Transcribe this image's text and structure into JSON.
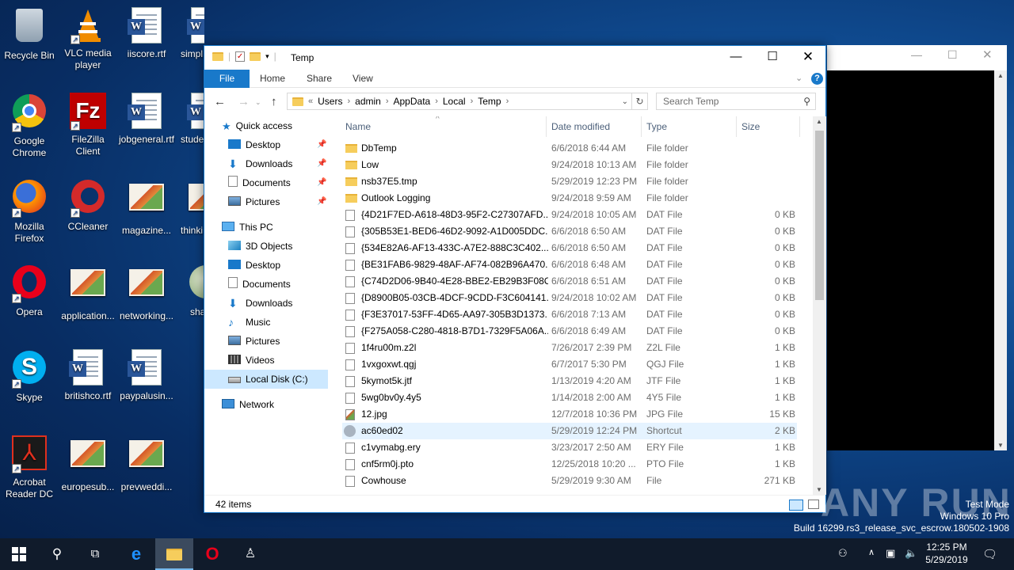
{
  "desktop": {
    "icons": [
      {
        "label": "Recycle Bin",
        "kind": "recycle"
      },
      {
        "label": "VLC media player",
        "kind": "vlc"
      },
      {
        "label": "iiscore.rtf",
        "kind": "word"
      },
      {
        "label": "simpl...",
        "kind": "word"
      },
      {
        "label": "Google Chrome",
        "kind": "chrome"
      },
      {
        "label": "FileZilla Client",
        "kind": "filezilla"
      },
      {
        "label": "jobgeneral.rtf",
        "kind": "word"
      },
      {
        "label": "stude...",
        "kind": "word"
      },
      {
        "label": "Mozilla Firefox",
        "kind": "firefox"
      },
      {
        "label": "CCleaner",
        "kind": "ccleaner"
      },
      {
        "label": "magazine...",
        "kind": "picture"
      },
      {
        "label": "thinki...",
        "kind": "picture"
      },
      {
        "label": "Opera",
        "kind": "opera"
      },
      {
        "label": "application...",
        "kind": "picture"
      },
      {
        "label": "networking...",
        "kind": "picture"
      },
      {
        "label": "sha...",
        "kind": "picture"
      },
      {
        "label": "Skype",
        "kind": "skype"
      },
      {
        "label": "britishco.rtf",
        "kind": "word"
      },
      {
        "label": "paypalusin...",
        "kind": "word"
      },
      {
        "label": "Acrobat Reader DC",
        "kind": "acrobat"
      },
      {
        "label": "europesub...",
        "kind": "picture"
      },
      {
        "label": "prevweddi...",
        "kind": "picture"
      }
    ]
  },
  "explorer": {
    "title": "Temp",
    "ribbon_tabs": [
      "File",
      "Home",
      "Share",
      "View"
    ],
    "address": {
      "prefix": "«",
      "crumbs": [
        "Users",
        "admin",
        "AppData",
        "Local",
        "Temp"
      ]
    },
    "search_placeholder": "Search Temp",
    "nav": {
      "quick_access": "Quick access",
      "quick_items": [
        "Desktop",
        "Downloads",
        "Documents",
        "Pictures"
      ],
      "this_pc": "This PC",
      "pc_items": [
        "3D Objects",
        "Desktop",
        "Documents",
        "Downloads",
        "Music",
        "Pictures",
        "Videos",
        "Local Disk (C:)"
      ],
      "network": "Network"
    },
    "columns": [
      "Name",
      "Date modified",
      "Type",
      "Size"
    ],
    "files": [
      {
        "name": "DbTemp",
        "date": "6/6/2018 6:44 AM",
        "type": "File folder",
        "size": "",
        "icon": "folder"
      },
      {
        "name": "Low",
        "date": "9/24/2018 10:13 AM",
        "type": "File folder",
        "size": "",
        "icon": "folder"
      },
      {
        "name": "nsb37E5.tmp",
        "date": "5/29/2019 12:23 PM",
        "type": "File folder",
        "size": "",
        "icon": "folder"
      },
      {
        "name": "Outlook Logging",
        "date": "9/24/2018 9:59 AM",
        "type": "File folder",
        "size": "",
        "icon": "folder"
      },
      {
        "name": "{4D21F7ED-A618-48D3-95F2-C27307AFD...",
        "date": "9/24/2018 10:05 AM",
        "type": "DAT File",
        "size": "0 KB",
        "icon": "file"
      },
      {
        "name": "{305B53E1-BED6-46D2-9092-A1D005DDC...",
        "date": "6/6/2018 6:50 AM",
        "type": "DAT File",
        "size": "0 KB",
        "icon": "file"
      },
      {
        "name": "{534E82A6-AF13-433C-A7E2-888C3C402...",
        "date": "6/6/2018 6:50 AM",
        "type": "DAT File",
        "size": "0 KB",
        "icon": "file"
      },
      {
        "name": "{BE31FAB6-9829-48AF-AF74-082B96A470...",
        "date": "6/6/2018 6:48 AM",
        "type": "DAT File",
        "size": "0 KB",
        "icon": "file"
      },
      {
        "name": "{C74D2D06-9B40-4E28-BBE2-EB29B3F08C...",
        "date": "6/6/2018 6:51 AM",
        "type": "DAT File",
        "size": "0 KB",
        "icon": "file"
      },
      {
        "name": "{D8900B05-03CB-4DCF-9CDD-F3C604141...",
        "date": "9/24/2018 10:02 AM",
        "type": "DAT File",
        "size": "0 KB",
        "icon": "file"
      },
      {
        "name": "{F3E37017-53FF-4D65-AA97-305B3D1373...",
        "date": "6/6/2018 7:13 AM",
        "type": "DAT File",
        "size": "0 KB",
        "icon": "file"
      },
      {
        "name": "{F275A058-C280-4818-B7D1-7329F5A06A...",
        "date": "6/6/2018 6:49 AM",
        "type": "DAT File",
        "size": "0 KB",
        "icon": "file"
      },
      {
        "name": "1f4ru00m.z2l",
        "date": "7/26/2017 2:39 PM",
        "type": "Z2L File",
        "size": "1 KB",
        "icon": "file"
      },
      {
        "name": "1vxgoxwt.qgj",
        "date": "6/7/2017 5:30 PM",
        "type": "QGJ File",
        "size": "1 KB",
        "icon": "file"
      },
      {
        "name": "5kymot5k.jtf",
        "date": "1/13/2019 4:20 AM",
        "type": "JTF File",
        "size": "1 KB",
        "icon": "file"
      },
      {
        "name": "5wg0bv0y.4y5",
        "date": "1/14/2018 2:00 AM",
        "type": "4Y5 File",
        "size": "1 KB",
        "icon": "file"
      },
      {
        "name": "12.jpg",
        "date": "12/7/2018 10:36 PM",
        "type": "JPG File",
        "size": "15 KB",
        "icon": "img"
      },
      {
        "name": "ac60ed02",
        "date": "5/29/2019 12:24 PM",
        "type": "Shortcut",
        "size": "2 KB",
        "icon": "lnk",
        "selected": true
      },
      {
        "name": "c1vymabg.ery",
        "date": "3/23/2017 2:50 AM",
        "type": "ERY File",
        "size": "1 KB",
        "icon": "file"
      },
      {
        "name": "cnf5rm0j.pto",
        "date": "12/25/2018 10:20 ...",
        "type": "PTO File",
        "size": "1 KB",
        "icon": "file"
      },
      {
        "name": "Cowhouse",
        "date": "5/29/2019 9:30 AM",
        "type": "File",
        "size": "271 KB",
        "icon": "file"
      }
    ],
    "status": "42 items"
  },
  "watermark": {
    "logo": "ANY RUN",
    "test_mode": "Test Mode",
    "edition": "Windows 10 Pro",
    "build": "Build 16299.rs3_release_svc_escrow.180502-1908"
  },
  "taskbar": {
    "time": "12:25 PM",
    "date": "5/29/2019"
  },
  "colors": {
    "accent": "#1979ca",
    "selection": "#e5f3ff",
    "taskbar": "#101b2b"
  }
}
